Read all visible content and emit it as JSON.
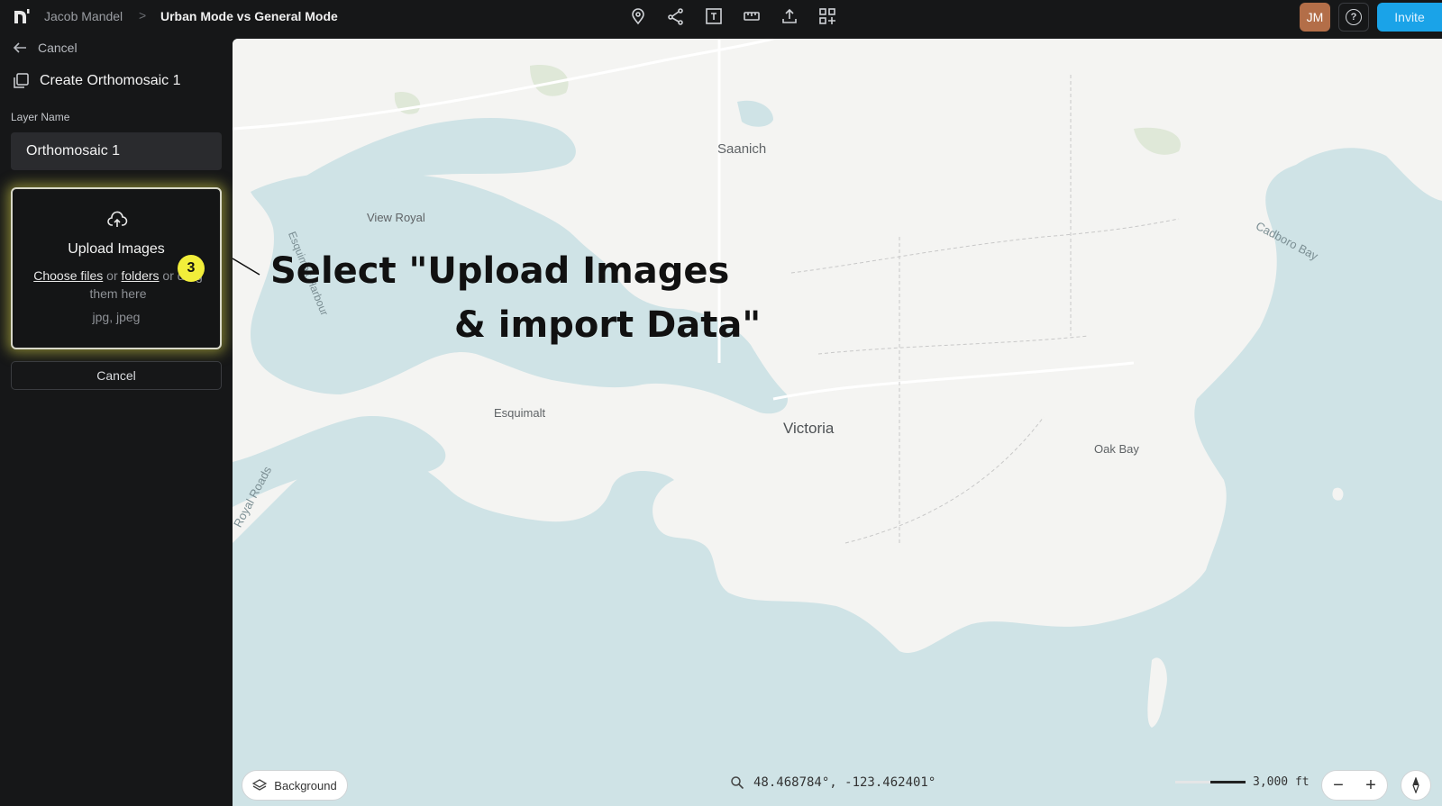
{
  "header": {
    "breadcrumb_user": "Jacob Mandel",
    "breadcrumb_separator": ">",
    "project_title": "Urban Mode vs General Mode",
    "tools": [
      "location-pin-icon",
      "share-node-icon",
      "text-frame-icon",
      "ruler-icon",
      "upload-icon",
      "apps-grid-icon"
    ],
    "avatar_initials": "JM",
    "help_symbol": "?",
    "invite_label": "Invite"
  },
  "sidebar": {
    "back_label": "Cancel",
    "title": "Create Orthomosaic 1",
    "layer_name_label": "Layer Name",
    "layer_name_value": "Orthomosaic 1",
    "upload": {
      "title": "Upload Images",
      "choose_files": "Choose files",
      "or": "or",
      "folders": "folders",
      "drag_text": "or drag them here",
      "file_types": "jpg, jpeg"
    },
    "step_number": "3",
    "cancel_label": "Cancel"
  },
  "map": {
    "places": {
      "saanich": "Saanich",
      "view_royal": "View Royal",
      "esquimalt_harbour": "Esquimalt Harbour",
      "cadboro_bay": "Cadboro Bay",
      "esquimalt": "Esquimalt",
      "victoria": "Victoria",
      "oak_bay": "Oak Bay",
      "royal_roads": "Royal Roads"
    },
    "annotation_line1": "Select \"Upload Images",
    "annotation_line2": "& import Data\"",
    "background_label": "Background",
    "coordinates": "48.468784°, -123.462401°",
    "scale_label": "3,000 ft",
    "zoom_out": "−",
    "zoom_in": "+",
    "colors": {
      "water": "#cfe3e6",
      "land": "#f4f4f2",
      "accent": "#1aa3e8",
      "highlight": "#f2ee3a"
    }
  }
}
